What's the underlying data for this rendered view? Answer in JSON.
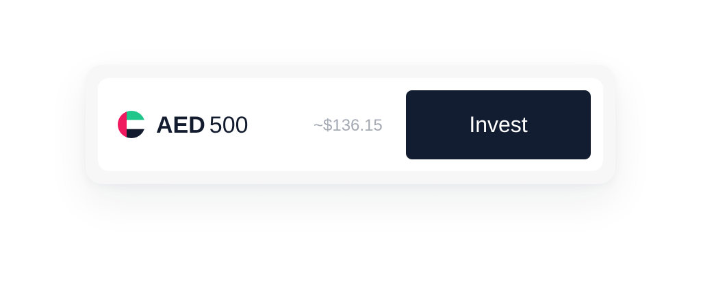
{
  "currency": {
    "code": "AED",
    "amount": "500",
    "flag_icon": "uae-flag-icon",
    "flag_colors": {
      "red": "#f0185e",
      "green": "#21c68b",
      "white": "#ffffff",
      "black": "#131c2f"
    }
  },
  "conversion": {
    "usd_estimate": "~$136.15"
  },
  "actions": {
    "invest_label": "Invest"
  },
  "colors": {
    "button_bg": "#131d31",
    "text_primary": "#131c2f",
    "text_muted": "#a4a9b3"
  }
}
